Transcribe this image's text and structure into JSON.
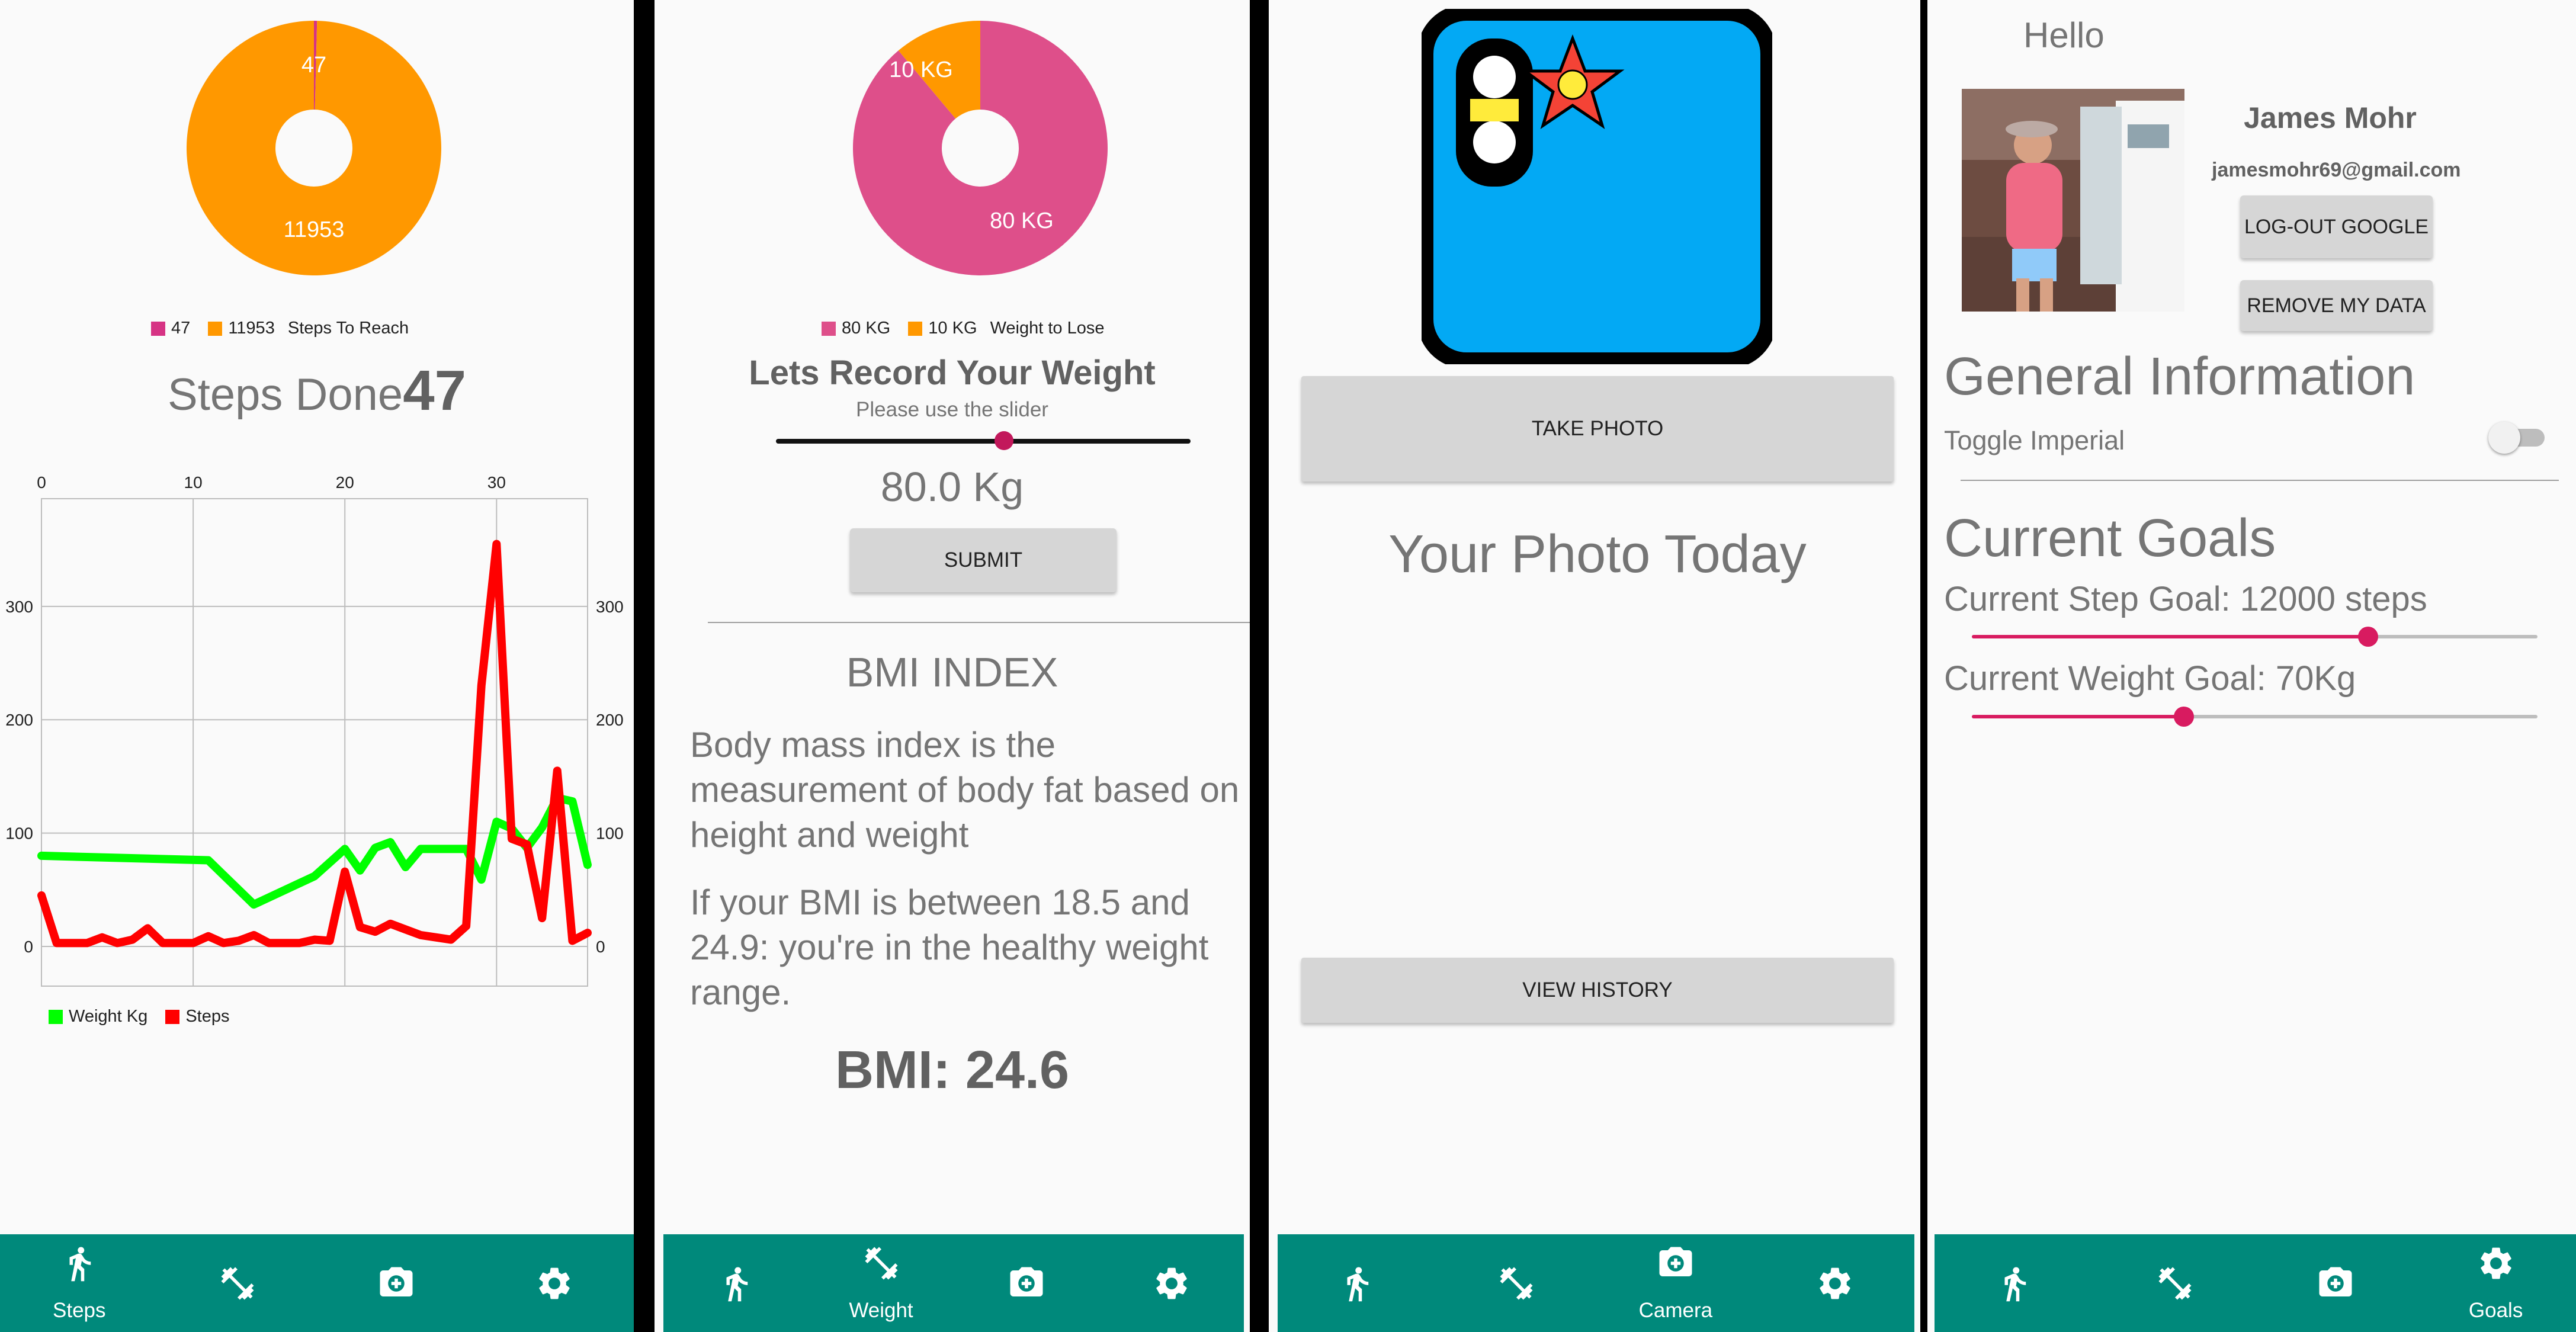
{
  "nav": {
    "steps_label": "Steps",
    "weight_label": "Weight",
    "camera_label": "Camera",
    "goals_label": "Goals"
  },
  "steps_screen": {
    "pie_done_label": "47",
    "pie_remaining_label": "11953",
    "legend_done": "47",
    "legend_remaining": "11953",
    "legend_title": "Steps To Reach",
    "steps_done_label": "Steps Done",
    "steps_done_value": "47",
    "legend_weight": "Weight Kg",
    "legend_steps": "Steps",
    "colors": {
      "done": "#d63384",
      "remaining": "#ff9800",
      "weight": "#00ff00",
      "steps": "#ff0000"
    }
  },
  "weight_screen": {
    "pie_current_label": "80 KG",
    "pie_tolose_label": "10 KG",
    "legend_current": "80 KG",
    "legend_tolose": "10 KG",
    "legend_title": "Weight to Lose",
    "title": "Lets Record Your Weight",
    "subtitle": "Please use the slider",
    "slider_value": 0.55,
    "weight_display": "80.0 Kg",
    "submit_label": "SUBMIT",
    "bmi_title": "BMI INDEX",
    "bmi_text1": "Body mass index is the measurement of body fat based on height and weight",
    "bmi_text2": "If your BMI is between 18.5 and 24.9: you're in the healthy weight range.",
    "bmi_result": "BMI: 24.6",
    "colors": {
      "current": "#de4f8a",
      "tolose": "#ff9800"
    }
  },
  "camera_screen": {
    "take_photo_label": "TAKE PHOTO",
    "photo_today_label": "Your Photo Today",
    "view_history_label": "VIEW HISTORY"
  },
  "goals_screen": {
    "greeting": "Hello",
    "user_name": "James Mohr",
    "user_email": "jamesmohr69@gmail.com",
    "logout_label": "LOG-OUT GOOGLE",
    "remove_data_label": "REMOVE MY DATA",
    "general_info_title": "General Information",
    "toggle_imperial_label": "Toggle Imperial",
    "toggle_imperial_on": false,
    "current_goals_title": "Current Goals",
    "step_goal_label": "Current Step Goal: 12000 steps",
    "step_goal_slider": 0.7,
    "weight_goal_label": "Current Weight Goal: 70Kg",
    "weight_goal_slider": 0.375
  },
  "chart_data": [
    {
      "type": "pie",
      "labels": [
        "47",
        "11953"
      ],
      "values": [
        47,
        11953
      ],
      "colors": [
        "#d63384",
        "#ff9800"
      ],
      "legend": [
        "47",
        "11953",
        "Steps To Reach"
      ]
    },
    {
      "type": "pie",
      "labels": [
        "80 KG",
        "10 KG"
      ],
      "values": [
        80,
        10
      ],
      "colors": [
        "#de4f8a",
        "#ff9800"
      ],
      "legend": [
        "80 KG",
        "10 KG",
        "Weight to Lose"
      ]
    },
    {
      "type": "line",
      "x_ticks_top": [
        "0",
        "10",
        "20",
        "30"
      ],
      "y_ticks_left": [
        "0",
        "100",
        "200",
        "300"
      ],
      "y_ticks_right": [
        "0",
        "100",
        "200",
        "300"
      ],
      "xlim": [
        0,
        36
      ],
      "ylim": [
        -35,
        395
      ],
      "grid": true,
      "legend_position": "bottom-left",
      "series": [
        {
          "name": "Weight Kg",
          "color": "#00ff00",
          "x": [
            0,
            11,
            14,
            18,
            20,
            21,
            22,
            23,
            24,
            25,
            26,
            28,
            29,
            30,
            31,
            32,
            33,
            34,
            35,
            36
          ],
          "y": [
            80,
            76,
            37,
            62,
            86,
            67,
            87,
            92,
            70,
            86,
            86,
            86,
            59,
            110,
            104,
            87,
            105,
            131,
            128,
            72
          ]
        },
        {
          "name": "Steps",
          "color": "#ff0000",
          "x": [
            0,
            1,
            2,
            3,
            4,
            5,
            6,
            7,
            8,
            9,
            10,
            11,
            12,
            13,
            14,
            15,
            16,
            17,
            18,
            19,
            20,
            21,
            22,
            23,
            24,
            25,
            26,
            27,
            28,
            29,
            30,
            31,
            32,
            33,
            34,
            35,
            36
          ],
          "y": [
            45,
            3,
            3,
            3,
            8,
            3,
            6,
            16,
            3,
            3,
            3,
            9,
            3,
            5,
            10,
            3,
            3,
            3,
            6,
            5,
            66,
            17,
            13,
            20,
            15,
            10,
            8,
            6,
            18,
            230,
            355,
            95,
            90,
            25,
            155,
            5,
            12
          ]
        }
      ]
    }
  ]
}
